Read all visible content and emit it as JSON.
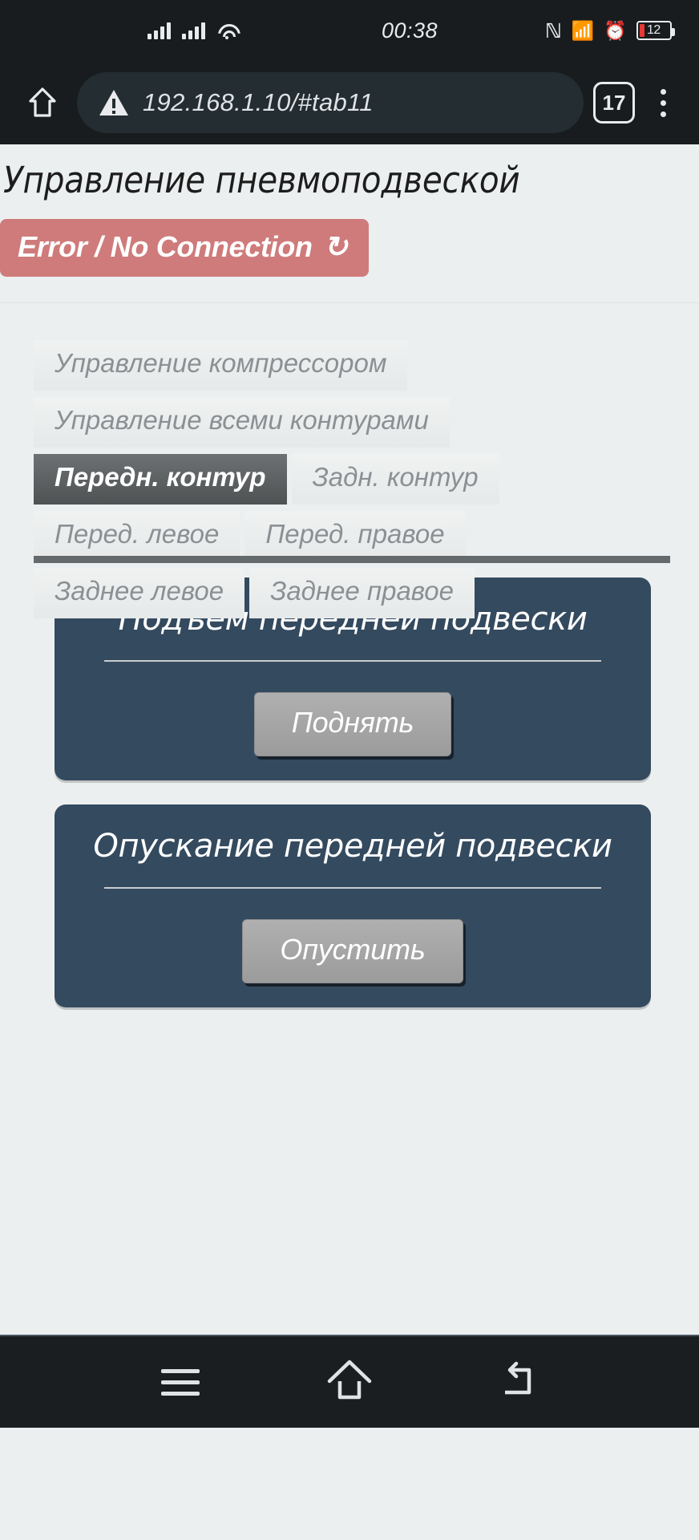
{
  "status_bar": {
    "time": "00:38",
    "battery_percent": "12",
    "icons": [
      "signal-icon",
      "signal-icon",
      "wifi-icon",
      "nfc-icon",
      "bluetooth-icon",
      "alarm-icon",
      "battery-icon"
    ]
  },
  "browser": {
    "url": "192.168.1.10/#tab11",
    "tab_count": "17",
    "home_icon": "home-icon",
    "security_icon": "insecure-warning-icon",
    "menu_icon": "overflow-menu-icon"
  },
  "page": {
    "title": "Управление пневмоподвеской",
    "status": {
      "label": "Error / No Connection",
      "refresh_glyph": "↻",
      "color": "#cf7b7b"
    },
    "tabs": [
      {
        "label": "Управление компрессором",
        "active": false
      },
      {
        "label": "Управление всеми контурами",
        "active": false
      },
      {
        "label": "Передн. контур",
        "active": true
      },
      {
        "label": "Задн. контур",
        "active": false
      },
      {
        "label": "Перед. левое",
        "active": false
      },
      {
        "label": "Перед. правое",
        "active": false
      },
      {
        "label": "Заднее левое",
        "active": false
      },
      {
        "label": "Заднее правое",
        "active": false
      }
    ],
    "cards": [
      {
        "title": "Подъем передней подвески",
        "button": "Поднять"
      },
      {
        "title": "Опускание передней подвески",
        "button": "Опустить"
      }
    ],
    "accent_card_color": "#344a5f"
  },
  "navbar": {
    "recents_icon": "hamburger-icon",
    "home_icon": "home-outline-icon",
    "back_icon": "back-arrow-icon"
  }
}
